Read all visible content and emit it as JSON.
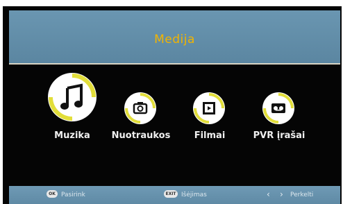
{
  "header": {
    "title": "Medija"
  },
  "menu": {
    "items": [
      {
        "label": "Muzika",
        "icon": "music-note-icon"
      },
      {
        "label": "Nuotraukos",
        "icon": "camera-icon"
      },
      {
        "label": "Filmai",
        "icon": "film-icon"
      },
      {
        "label": "PVR įrašai",
        "icon": "recorder-icon"
      }
    ]
  },
  "footer": {
    "ok_key": "OK",
    "ok_label": "Pasirink",
    "exit_key": "EXIT",
    "exit_label": "Išėjimas",
    "move_label": "Perkelti"
  },
  "colors": {
    "accent": "#f2b400",
    "bar": "#5f8aa5",
    "ring_arc": "#e2de3a"
  }
}
